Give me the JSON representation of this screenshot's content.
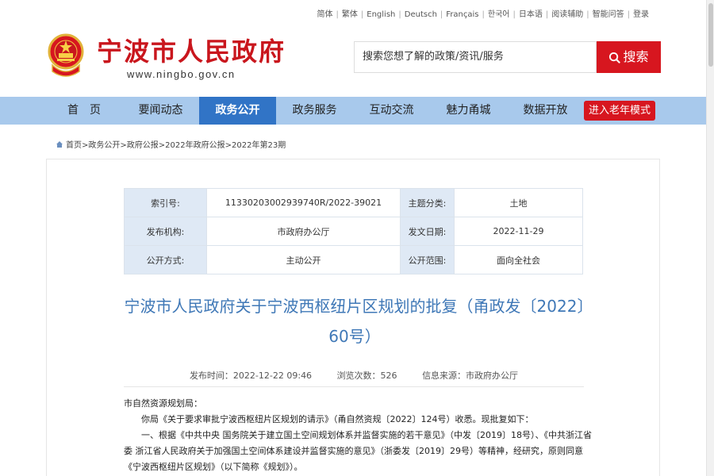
{
  "langbar": [
    "简体",
    "繁体",
    "English",
    "Deutsch",
    "Français",
    "한국어",
    "日本语",
    "阅读辅助",
    "智能问答",
    "登录"
  ],
  "header": {
    "title": "宁波市人民政府",
    "url": "www.ningbo.gov.cn",
    "search_placeholder": "搜索您想了解的政策/资讯/服务",
    "search_button": "搜索"
  },
  "nav": {
    "items": [
      "首　页",
      "要闻动态",
      "政务公开",
      "政务服务",
      "互动交流",
      "魅力甬城",
      "数据开放"
    ],
    "active_index": 2,
    "elder_mode": "进入老年模式"
  },
  "breadcrumb": [
    "首页",
    "政务公开",
    "政府公报",
    "2022年政府公报",
    "2022年第23期"
  ],
  "meta": {
    "index_label": "索引号:",
    "index_value": "11330203002939740R/2022-39021",
    "topic_label": "主题分类:",
    "topic_value": "土地",
    "org_label": "发布机构:",
    "org_value": "市政府办公厅",
    "date_label": "发文日期:",
    "date_value": "2022-11-29",
    "mode_label": "公开方式:",
    "mode_value": "主动公开",
    "scope_label": "公开范围:",
    "scope_value": "面向全社会"
  },
  "document": {
    "title": "宁波市人民政府关于宁波西枢纽片区规划的批复（甬政发〔2022〕60号）",
    "publish_time": "发布时间：2022-12-22 09:46",
    "views": "浏览次数：526",
    "source": "信息来源：市政府办公厅",
    "addressee": "市自然资源规划局：",
    "para1": "你局《关于要求审批宁波西枢纽片区规划的请示》（甬自然资规〔2022〕124号）收悉。现批复如下：",
    "para2": "一、根据《中共中央 国务院关于建立国土空间规划体系并监督实施的若干意见》（中发〔2019〕18号）、《中共浙江省委 浙江省人民政府关于加强国土空间体系建设并监督实施的意见》（浙委发〔2019〕29号）等精神，经研究，原则同意《宁波西枢纽片区规划》（以下简称《规划》）。"
  },
  "colors": {
    "brand_red": "#c9161d",
    "nav_bg": "#a8c9ec",
    "nav_active": "#3174c6",
    "title_blue": "#3f78b7",
    "table_label_bg": "#dfe9f5"
  }
}
